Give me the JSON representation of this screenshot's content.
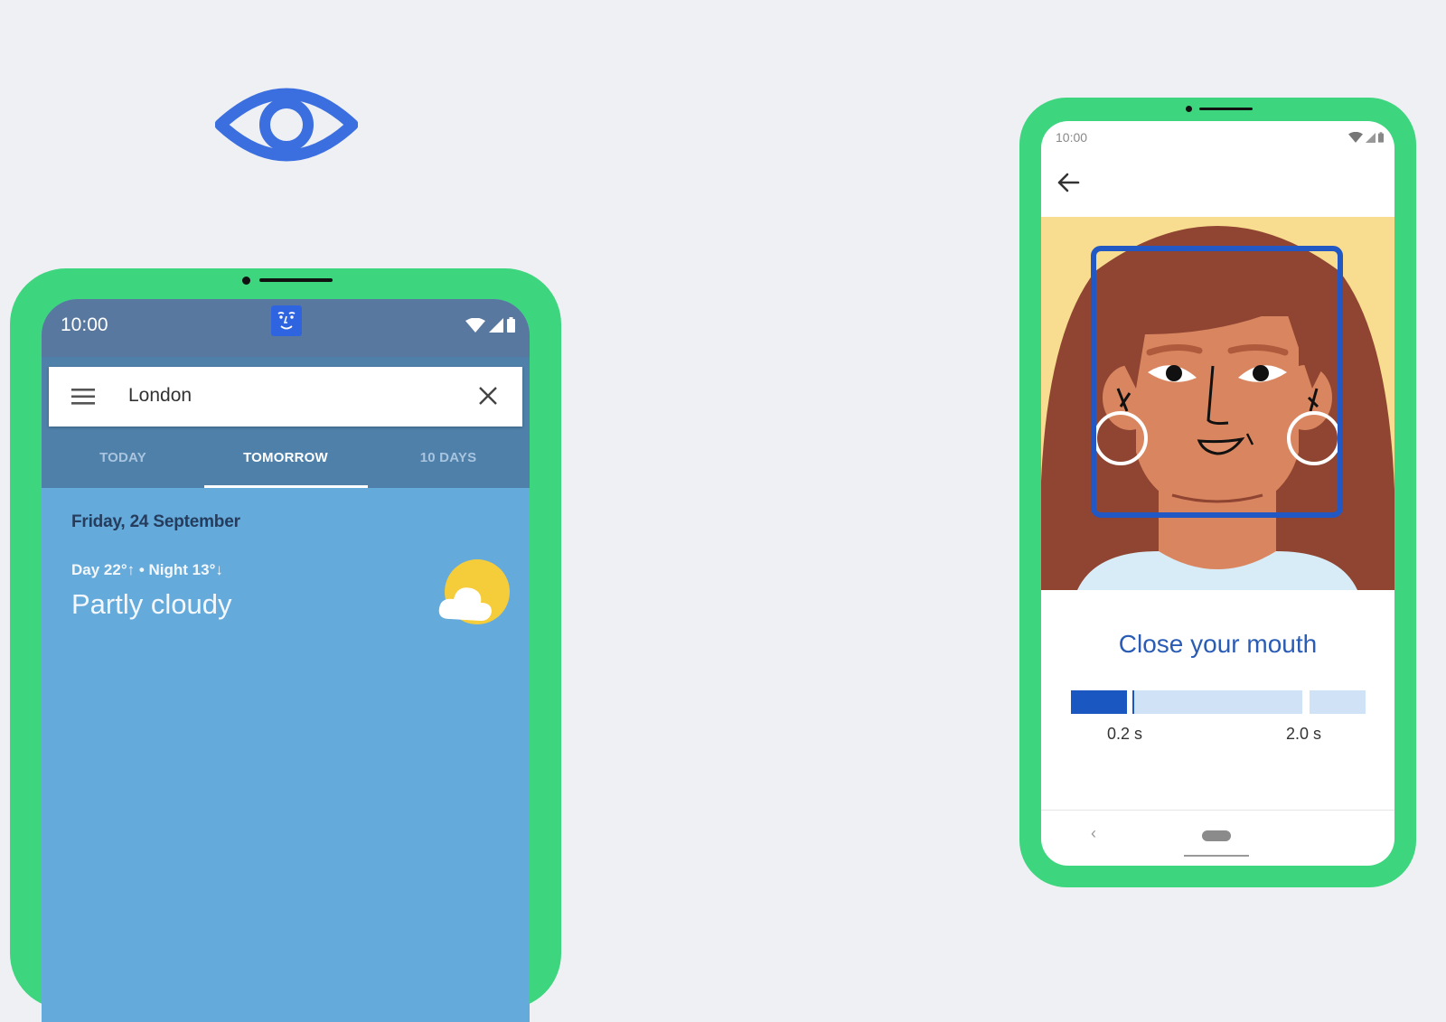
{
  "decor": {
    "eye_icon": "eye-icon",
    "accent_color": "#3b6fe0",
    "phone_frame_color": "#3ed57f"
  },
  "left_phone": {
    "status_bar": {
      "time": "10:00",
      "center_icon": "face-badge-icon",
      "icons": [
        "wifi-icon",
        "signal-icon",
        "battery-icon"
      ]
    },
    "search": {
      "menu_icon": "hamburger-menu-icon",
      "query": "London",
      "clear_icon": "close-icon"
    },
    "tabs": [
      {
        "label": "TODAY",
        "active": false
      },
      {
        "label": "TOMORROW",
        "active": true
      },
      {
        "label": "10 DAYS",
        "active": false
      }
    ],
    "forecast": {
      "date": "Friday, 24 September",
      "temps": "Day 22°↑ • Night 13°↓",
      "condition": "Partly cloudy",
      "icon": "partly-cloudy-icon"
    }
  },
  "right_phone": {
    "status_bar": {
      "time": "10:00",
      "icons": [
        "wifi-icon",
        "signal-icon",
        "battery-icon"
      ]
    },
    "back_icon": "arrow-back-icon",
    "illustration": "face-with-detection-box",
    "prompt": "Close your mouth",
    "progress": {
      "elapsed_fraction": 0.19,
      "marker_fraction": 0.21,
      "labels": [
        {
          "text": "0.2 s"
        },
        {
          "text": "2.0 s"
        }
      ]
    },
    "nav": {
      "back": "‹",
      "home": "home-pill",
      "gesture": "gesture-bar"
    }
  }
}
